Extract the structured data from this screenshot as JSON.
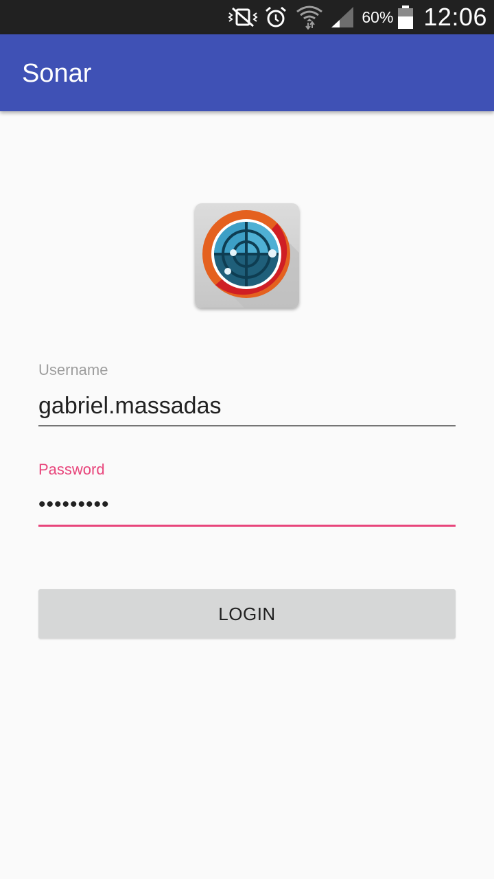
{
  "status_bar": {
    "battery_percent": "60%",
    "time": "12:06",
    "icons": [
      "vibrate-mute-icon",
      "alarm-icon",
      "wifi-icon",
      "signal-icon",
      "battery-icon"
    ]
  },
  "app_bar": {
    "title": "Sonar",
    "color": "#3f51b5"
  },
  "logo": {
    "icon": "sonar-radar-logo"
  },
  "form": {
    "username": {
      "label": "Username",
      "value": "gabriel.massadas"
    },
    "password": {
      "label": "Password",
      "value": "•••••••••"
    },
    "login_label": "LOGIN"
  },
  "colors": {
    "accent": "#e8457b",
    "primary": "#3f51b5",
    "background": "#fafafa"
  }
}
